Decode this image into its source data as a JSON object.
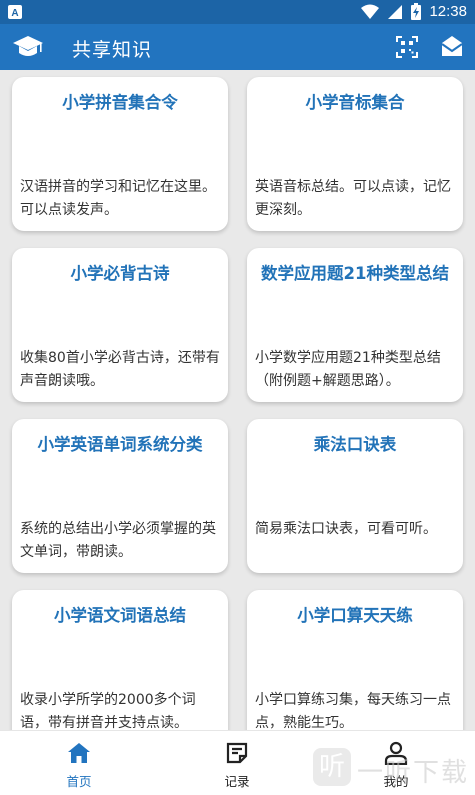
{
  "status_bar": {
    "time": "12:38",
    "left_icon": "a-notification-icon",
    "icons": [
      "wifi-icon",
      "signal-icon",
      "battery-charging-icon"
    ]
  },
  "app_bar": {
    "title": "共享知识",
    "logo_icon": "graduation-cap-icon",
    "actions": [
      "qr-scan-icon",
      "mail-open-icon"
    ],
    "color": "#2274bf"
  },
  "cards": [
    {
      "title": "小学拼音集合令",
      "desc": "汉语拼音的学习和记忆在这里。可以点读发声。"
    },
    {
      "title": "小学音标集合",
      "desc": "英语音标总结。可以点读，记忆更深刻。"
    },
    {
      "title": "小学必背古诗",
      "desc": "收集80首小学必背古诗，还带有声音朗读哦。"
    },
    {
      "title": "数学应用题21种类型总结",
      "desc": "小学数学应用题21种类型总结（附例题+解题思路）。"
    },
    {
      "title": "小学英语单词系统分类",
      "desc": "系统的总结出小学必须掌握的英文单词，带朗读。"
    },
    {
      "title": "乘法口诀表",
      "desc": "简易乘法口诀表，可看可听。"
    },
    {
      "title": "小学语文词语总结",
      "desc": "收录小学所学的2000多个词语，带有拼音并支持点读。"
    },
    {
      "title": "小学口算天天练",
      "desc": "小学口算练习集，每天练习一点点，熟能生巧。"
    }
  ],
  "bottom_nav": {
    "items": [
      {
        "label": "首页",
        "icon": "home-icon",
        "active": true
      },
      {
        "label": "记录",
        "icon": "records-icon",
        "active": false
      },
      {
        "label": "我的",
        "icon": "user-icon",
        "active": false
      }
    ],
    "active_color": "#2274bf"
  },
  "watermark": {
    "glyph": "听",
    "text": "一听下载"
  }
}
